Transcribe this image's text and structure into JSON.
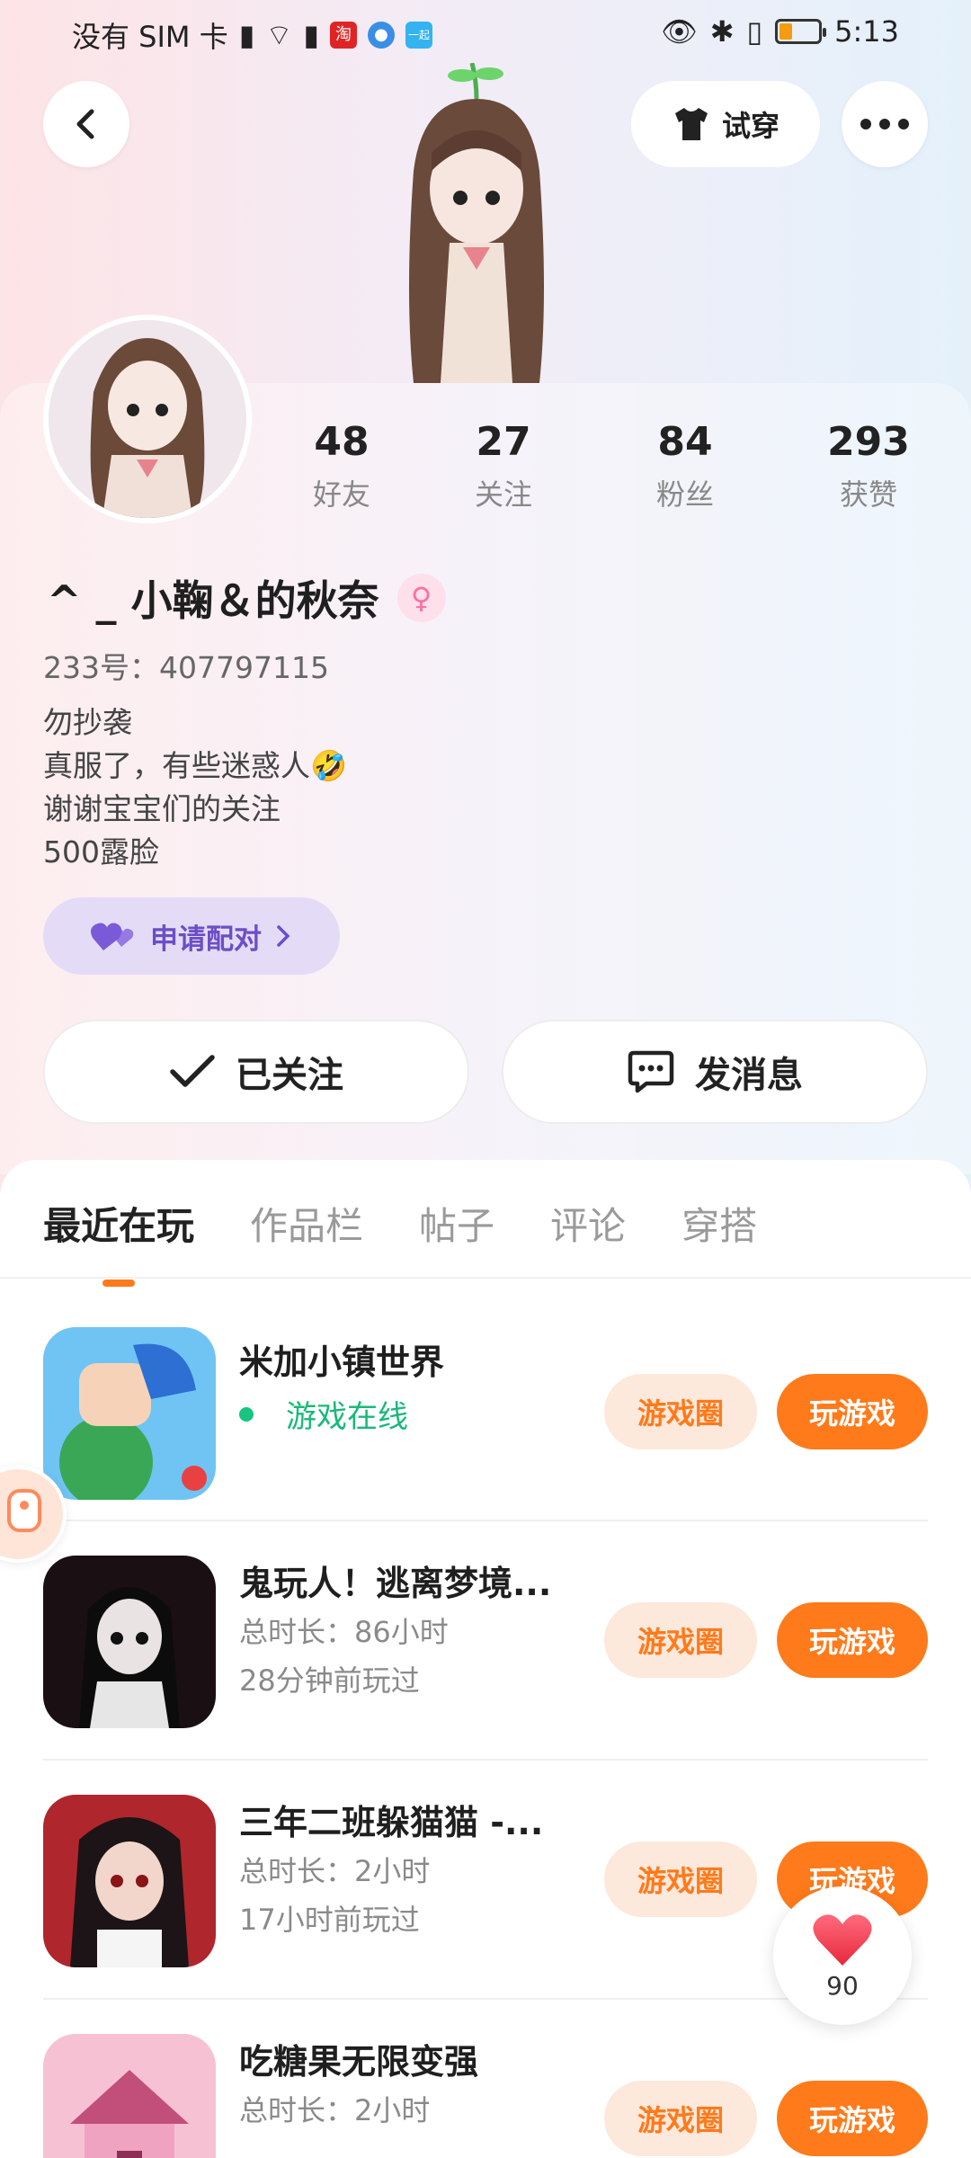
{
  "status_bar": {
    "carrier": "没有 SIM 卡",
    "time": "5:13",
    "app_icons": [
      "淘",
      "●",
      "一起"
    ]
  },
  "header": {
    "back_icon": "chevron-left-icon",
    "try_on_label": "试穿",
    "more_icon": "more-dots-icon"
  },
  "profile": {
    "stats": [
      {
        "value": "48",
        "label": "好友"
      },
      {
        "value": "27",
        "label": "关注"
      },
      {
        "value": "84",
        "label": "粉丝"
      },
      {
        "value": "293",
        "label": "获赞"
      }
    ],
    "username": "^ _ 小鞠＆的秋奈",
    "gender_symbol": "♀",
    "uid": "233号：407797115",
    "bio": [
      "勿抄袭",
      "真服了，有些迷惑人🤣",
      "谢谢宝宝们的关注",
      "500露脸"
    ],
    "pair_label": "申请配对",
    "follow_label": "已关注",
    "message_label": "发消息"
  },
  "tabs": [
    "最近在玩",
    "作品栏",
    "帖子",
    "评论",
    "穿搭"
  ],
  "games": [
    {
      "title": "米加小镇世界",
      "online_text": "游戏在线",
      "circle_label": "游戏圈",
      "play_label": "玩游戏"
    },
    {
      "title": "鬼玩人！逃离梦境...",
      "duration": "总时长：86小时",
      "last_played": "28分钟前玩过",
      "circle_label": "游戏圈",
      "play_label": "玩游戏"
    },
    {
      "title": "三年二班躲猫猫 -...",
      "duration": "总时长：2小时",
      "last_played": "17小时前玩过",
      "circle_label": "游戏圈",
      "play_label": "玩游戏"
    },
    {
      "title": "吃糖果无限变强",
      "duration": "总时长：2小时",
      "circle_label": "游戏圈",
      "play_label": "玩游戏"
    }
  ],
  "like_count": "90",
  "colors": {
    "accent": "#ff7a1a",
    "online": "#19b97a",
    "pair": "#6a4fc7"
  }
}
